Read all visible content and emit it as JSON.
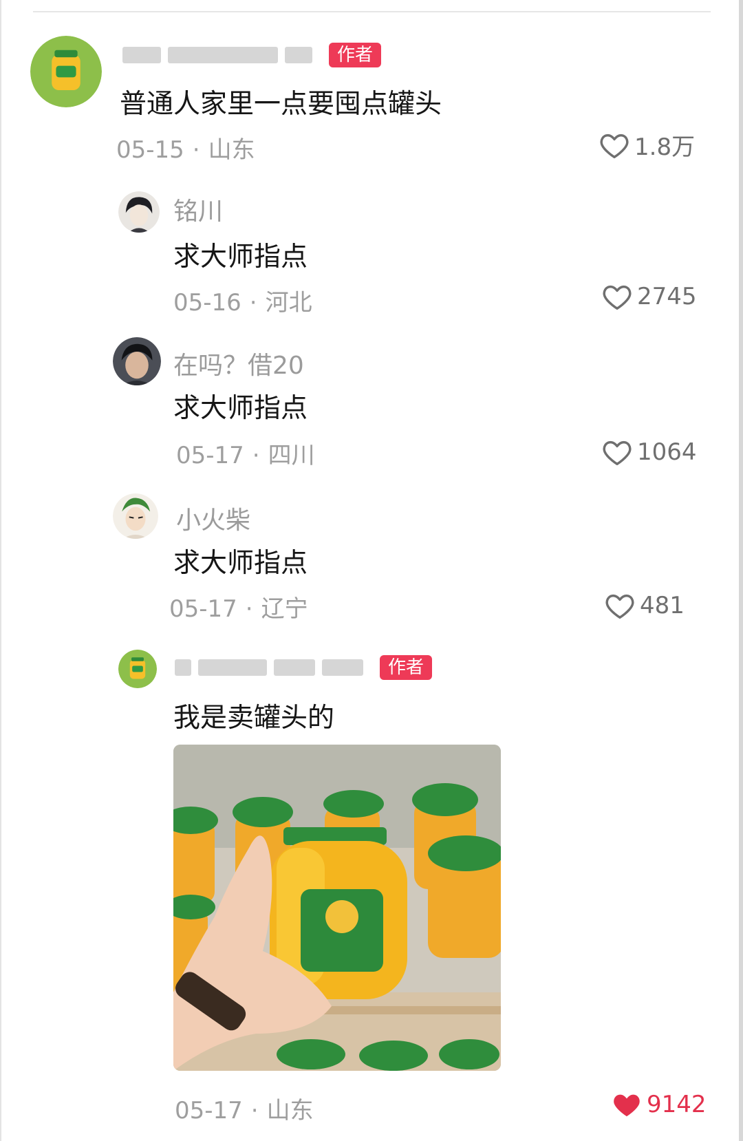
{
  "comments": [
    {
      "author_badge": "作者",
      "text": "普通人家里一点要囤点罐头",
      "date": "05-15",
      "location": "山东",
      "likes": "1.8万"
    },
    {
      "username": "铭川",
      "text": "求大师指点",
      "date": "05-16",
      "location": "河北",
      "likes": "2745"
    },
    {
      "username": "在吗？借20",
      "text": "求大师指点",
      "date": "05-17",
      "location": "四川",
      "likes": "1064"
    },
    {
      "username": "小火柴",
      "text": "求大师指点",
      "date": "05-17",
      "location": "辽宁",
      "likes": "481"
    },
    {
      "author_badge": "作者",
      "text": "我是卖罐头的",
      "date": "05-17",
      "location": "山东",
      "likes": "9142"
    }
  ],
  "separator": "·",
  "colors": {
    "author_badge_bg": "#ee3a57",
    "liked_heart": "#e3304c",
    "meta_text": "#9e9e9e",
    "body_text": "#161616"
  },
  "icons": {
    "like": "heart-outline-icon",
    "liked": "heart-filled-icon"
  }
}
